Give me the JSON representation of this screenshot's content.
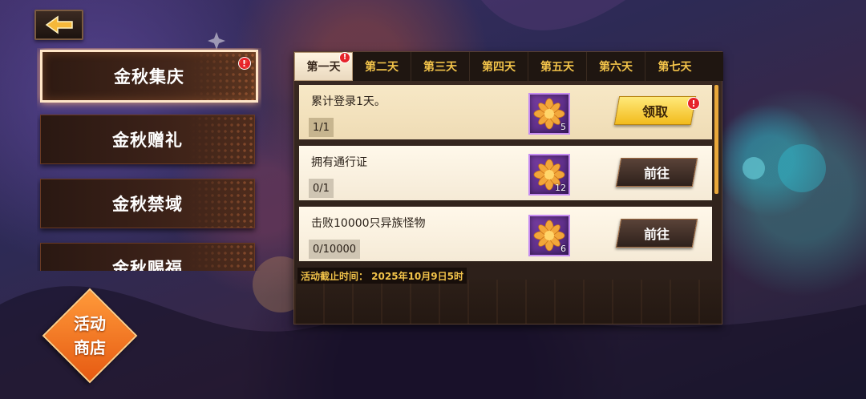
{
  "sidebar": {
    "items": [
      {
        "label": "金秋集庆",
        "active": true,
        "has_alert": true
      },
      {
        "label": "金秋赠礼",
        "active": false,
        "has_alert": false
      },
      {
        "label": "金秋禁域",
        "active": false,
        "has_alert": false
      },
      {
        "label": "金秋赐福",
        "active": false,
        "has_alert": false
      }
    ],
    "shop_button": {
      "line1": "活动",
      "line2": "商店"
    }
  },
  "alert_mark": "!",
  "tabs": [
    {
      "label": "第一天",
      "active": true,
      "has_alert": true
    },
    {
      "label": "第二天",
      "active": false
    },
    {
      "label": "第三天",
      "active": false
    },
    {
      "label": "第四天",
      "active": false
    },
    {
      "label": "第五天",
      "active": false
    },
    {
      "label": "第六天",
      "active": false
    },
    {
      "label": "第七天",
      "active": false
    }
  ],
  "tasks": [
    {
      "title": "累计登录1天。",
      "progress": "1/1",
      "reward_count": "5",
      "button": "领取",
      "button_type": "claim",
      "has_alert": true
    },
    {
      "title": "拥有通行证",
      "progress": "0/1",
      "reward_count": "12",
      "button": "前往",
      "button_type": "go",
      "has_alert": false
    },
    {
      "title": "击败10000只异族怪物",
      "progress": "0/10000",
      "reward_count": "6",
      "button": "前往",
      "button_type": "go",
      "has_alert": false
    }
  ],
  "deadline": "活动截止时间： 2025年10月9日5时",
  "colors": {
    "accent_gold": "#f2c34a",
    "alert_red": "#e6232a",
    "reward_purple": "#7a3fa5"
  },
  "icons": {
    "back": "back-arrow-icon",
    "reward": "chrysanthemum-icon"
  }
}
